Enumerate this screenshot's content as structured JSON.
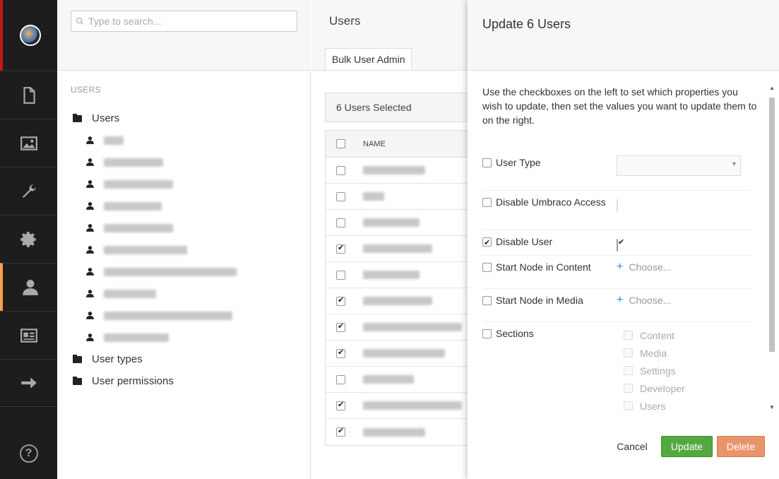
{
  "rail": {
    "items": [
      {
        "name": "content-section",
        "icon": "document-icon"
      },
      {
        "name": "media-section",
        "icon": "image-icon"
      },
      {
        "name": "settings-section",
        "icon": "wrench-icon"
      },
      {
        "name": "developer-section",
        "icon": "gear-icon"
      },
      {
        "name": "users-section",
        "icon": "user-icon",
        "active": true
      },
      {
        "name": "members-section",
        "icon": "id-card-icon"
      },
      {
        "name": "forms-section",
        "icon": "arrow-right-icon"
      }
    ],
    "help_label": "?"
  },
  "tree": {
    "search_placeholder": "Type to search...",
    "section_label": "USERS",
    "users_label": "Users",
    "user_types_label": "User types",
    "user_permissions_label": "User permissions"
  },
  "main": {
    "title": "Users",
    "tab_label": "Bulk User Admin",
    "selected_label": "6 Users Selected",
    "column_name": "NAME",
    "rows_checked": [
      false,
      false,
      false,
      true,
      false,
      true,
      true,
      true,
      false,
      true,
      true
    ]
  },
  "dialog": {
    "title": "Update 6 Users",
    "intro": "Use the checkboxes on the left to set which properties you wish to update, then set the values you want to update them to on the right.",
    "props": {
      "user_type": "User Type",
      "disable_umbraco_access": "Disable Umbraco Access",
      "disable_user": "Disable User",
      "start_node_content": "Start Node in Content",
      "start_node_media": "Start Node in Media",
      "sections": "Sections"
    },
    "choose_label": "Choose...",
    "plus_symbol": "+",
    "sections_list": [
      "Content",
      "Media",
      "Settings",
      "Developer",
      "Users"
    ],
    "cancel_label": "Cancel",
    "update_label": "Update",
    "delete_label": "Delete"
  },
  "colors": {
    "rail_bg": "#1d1d1d",
    "active_accent": "#f5a24b",
    "update_button": "#53a93f",
    "delete_button": "#e8956b",
    "link_plus": "#2e8aea"
  }
}
